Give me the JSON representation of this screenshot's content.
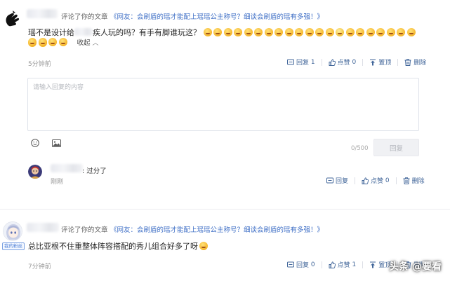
{
  "comment1": {
    "action_text": "评论了你的文章",
    "article_link": "《网友：会刷盾的瑶才能配上瑶瑶公主称号？细谈会刷盾的瑶有多强！》",
    "text_part1": "瑶不是设计给",
    "text_part2": "疾人玩的吗？有手有脚谁玩这？",
    "collapse_label": "收起",
    "time": "5分钟前",
    "reply_label": "回复",
    "reply_count": "1",
    "like_label": "点赞",
    "like_count": "0",
    "pin_label": "置顶",
    "delete_label": "删除"
  },
  "reply_editor": {
    "placeholder": "请输入回复的内容",
    "counter": "0/500",
    "submit_label": "回复"
  },
  "reply1": {
    "text": ": 过分了",
    "time": "刚刚",
    "reply_label": "回复",
    "like_label": "点赞",
    "like_count": "0",
    "delete_label": "删除"
  },
  "comment2": {
    "badge": "我的粉丝",
    "action_text": "评论了你的文章",
    "article_link": "《网友：会刷盾的瑶才能配上瑶瑶公主称号？细谈会刷盾的瑶有多强！》",
    "text": "总比亚根不住重整体阵容搭配的秀儿组合好多了呀",
    "time": "7分钟前",
    "reply_label": "回复",
    "reply_count": "0",
    "like_label": "点赞",
    "like_count": "1",
    "pin_label": "置顶",
    "delete_label": "删除"
  },
  "watermark": "头条 @要看",
  "colors": {
    "link": "#3f6fc6",
    "action": "#406599",
    "muted": "#999999"
  }
}
